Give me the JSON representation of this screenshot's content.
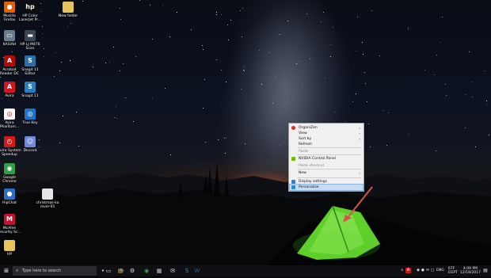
{
  "desktop_icons": [
    {
      "name": "firefox-icon",
      "label_lines": [
        "Mozilla",
        "Firefox"
      ],
      "color": "#e66000",
      "glyph": "●"
    },
    {
      "name": "hp-printer-launcher-icon",
      "label_lines": [
        "HP Color",
        "LaserJet Pr..."
      ],
      "color": "#0d0d0d",
      "glyph": "hp"
    },
    {
      "name": "new-folder-icon",
      "label_lines": [
        "New folder"
      ],
      "color": "#e8c45a",
      "glyph": ""
    },
    {
      "name": "kasiah-computer-icon",
      "label_lines": [
        "KASIAH"
      ],
      "color": "#6b7a8c",
      "glyph": "▭"
    },
    {
      "name": "hp-scan-icon",
      "label_lines": [
        "HP LJ M476",
        "Scan"
      ],
      "color": "#3c4552",
      "glyph": "▬"
    },
    {
      "name": "acrobat-reader-icon",
      "label_lines": [
        "Acrobat",
        "Reader DC"
      ],
      "color": "#b30b00",
      "glyph": "A"
    },
    {
      "name": "snagit-editor-icon",
      "label_lines": [
        "Snagit 11",
        "Editor"
      ],
      "color": "#2d6ea8",
      "glyph": "S"
    },
    {
      "name": "avira-icon",
      "label_lines": [
        "Avira"
      ],
      "color": "#d5141f",
      "glyph": "A"
    },
    {
      "name": "snagit-icon",
      "label_lines": [
        "Snagit 11"
      ],
      "color": "#2b7dc1",
      "glyph": "S"
    },
    {
      "name": "avira-phantom-vpn-icon",
      "label_lines": [
        "Avira",
        "Phantom..."
      ],
      "color": "#ffffff",
      "glyph": "◎"
    },
    {
      "name": "true-key-icon",
      "label_lines": [
        "True Key"
      ],
      "color": "#1d74c7",
      "glyph": "◎"
    },
    {
      "name": "avira-system-speedup-icon",
      "label_lines": [
        "Avira System",
        "Speedup"
      ],
      "color": "#d11a1a",
      "glyph": "◴"
    },
    {
      "name": "discord-icon",
      "label_lines": [
        "Discord"
      ],
      "color": "#7289da",
      "glyph": "☺"
    },
    {
      "name": "google-chrome-icon",
      "label_lines": [
        "Google",
        "Chrome"
      ],
      "color": "#2d9f47",
      "glyph": "◉"
    },
    {
      "name": "hipchat-icon",
      "label_lines": [
        "HipChat"
      ],
      "color": "#2b6fc9",
      "glyph": "●"
    },
    {
      "name": "christmas-image-icon",
      "label_lines": [
        "christmas-ka",
        "rover-01"
      ],
      "color": "#e6e6e6",
      "glyph": ""
    },
    {
      "name": "mcafee-icon",
      "label_lines": [
        "McAfee",
        "Security Sc..."
      ],
      "color": "#c8102e",
      "glyph": "M"
    },
    {
      "name": "hp-folder-icon",
      "label_lines": [
        "HP"
      ],
      "color": "#e8c45a",
      "glyph": ""
    }
  ],
  "context_menu": {
    "items": [
      {
        "label": "OrganiZen",
        "has_submenu": true,
        "disabled": false,
        "icon": "organizen-icon"
      },
      {
        "label": "View",
        "has_submenu": true,
        "disabled": false,
        "icon": ""
      },
      {
        "label": "Sort by",
        "has_submenu": true,
        "disabled": false,
        "icon": ""
      },
      {
        "label": "Refresh",
        "has_submenu": false,
        "disabled": false,
        "icon": ""
      },
      {
        "label": "Paste",
        "has_submenu": false,
        "disabled": true,
        "icon": ""
      },
      {
        "label": "NVIDIA Control Panel",
        "has_submenu": false,
        "disabled": false,
        "icon": "nvidia-icon"
      },
      {
        "label": "Paste shortcut",
        "has_submenu": false,
        "disabled": true,
        "icon": ""
      },
      {
        "label": "New",
        "has_submenu": true,
        "disabled": false,
        "icon": ""
      },
      {
        "label": "Display settings",
        "has_submenu": false,
        "disabled": false,
        "icon": "display-icon"
      },
      {
        "label": "Personalize",
        "has_submenu": false,
        "disabled": false,
        "icon": "personalize-icon",
        "highlighted": true
      }
    ],
    "submenu_arrow": "›"
  },
  "taskbar": {
    "start_glyph": "⊞",
    "search_placeholder": "Type here to search",
    "search_glyph": "⌕",
    "pinned": [
      {
        "name": "microphone-icon",
        "glyph": "•",
        "color": "#e6e6e6"
      },
      {
        "name": "task-view-icon",
        "glyph": "▭",
        "color": "#e6e6e6"
      },
      {
        "name": "photoshop-icon",
        "glyph": "Ps",
        "color": "#31a8ff"
      },
      {
        "name": "settings-icon",
        "glyph": "⚙",
        "color": "#e6e6e6"
      },
      {
        "name": "file-explorer-icon",
        "glyph": "▤",
        "color": "#f2c94c"
      },
      {
        "name": "chrome-taskbar-icon",
        "glyph": "◉",
        "color": "#34a853"
      },
      {
        "name": "calculator-icon",
        "glyph": "▦",
        "color": "#cccccc"
      },
      {
        "name": "mail-icon",
        "glyph": "✉",
        "color": "#e6e6e6"
      },
      {
        "name": "skype-icon",
        "glyph": "S",
        "color": "#00aff0"
      },
      {
        "name": "word-icon",
        "glyph": "W",
        "color": "#2b579a"
      }
    ],
    "tray": {
      "chevron": "∧",
      "tray_glyphs": [
        "◉",
        "●",
        "✉",
        "□"
      ],
      "avira_glyph": "A",
      "language": "ENG",
      "time": "4:09 PM",
      "date": "12/18/2017",
      "weather_line1": "67F",
      "weather_line2": "EGPT",
      "notification_glyph": "▤"
    }
  },
  "colors": {
    "menu_highlight": "#c7dcf3",
    "annotation_arrow": "#d9534f",
    "tent_green": "#5fcf2a"
  }
}
